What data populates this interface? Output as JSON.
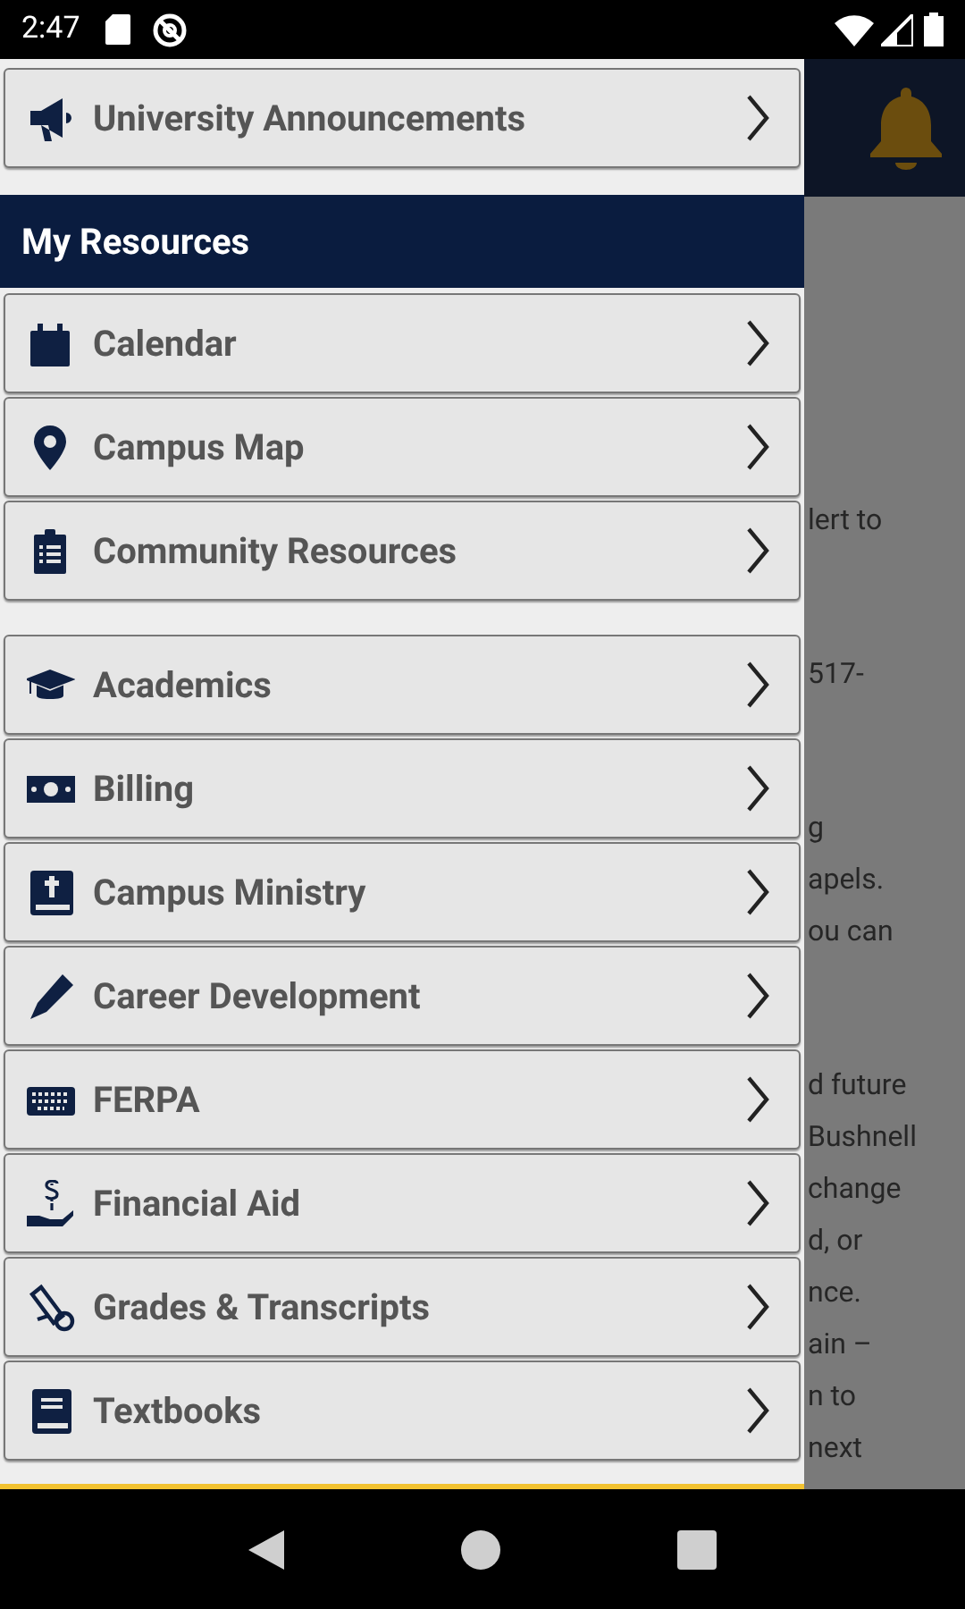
{
  "status_bar": {
    "time": "2:47"
  },
  "drawer": {
    "top_items": [
      {
        "label": "University Announcements"
      }
    ],
    "section": {
      "title": "My Resources"
    },
    "groups": [
      [
        {
          "label": "Calendar"
        },
        {
          "label": "Campus Map"
        },
        {
          "label": "Community Resources"
        }
      ],
      [
        {
          "label": "Academics"
        },
        {
          "label": "Billing"
        },
        {
          "label": "Campus Ministry"
        },
        {
          "label": "Career Development"
        },
        {
          "label": "FERPA"
        },
        {
          "label": "Financial Aid"
        },
        {
          "label": "Grades & Transcripts"
        },
        {
          "label": "Textbooks"
        }
      ]
    ]
  },
  "background_page": {
    "paragraphs": [
      [
        "lert to"
      ],
      [
        "517-"
      ],
      [
        "g",
        "apels.",
        "ou can"
      ],
      [
        "d future",
        "Bushnell",
        "change",
        "d, or",
        "nce.",
        "ain –",
        "n to",
        "next"
      ]
    ]
  }
}
